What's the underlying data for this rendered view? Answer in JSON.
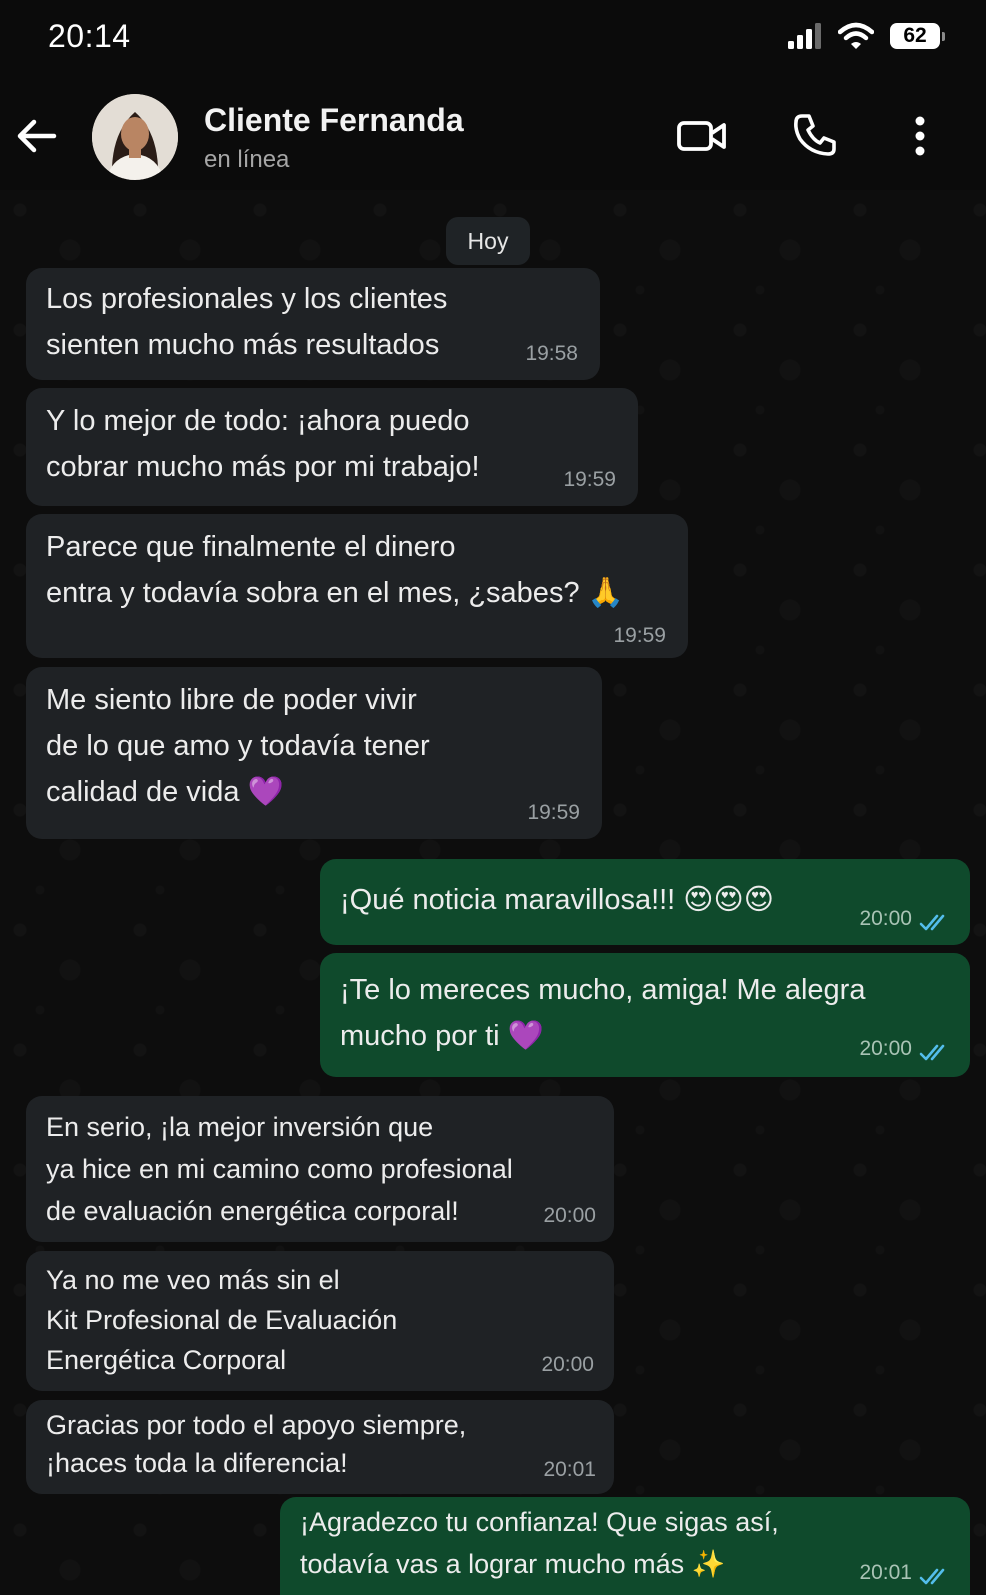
{
  "status_bar": {
    "time": "20:14",
    "signal_icon": "signal-bars-icon",
    "wifi_icon": "wifi-icon",
    "battery_level": "62"
  },
  "header": {
    "contact_name": "Cliente Fernanda",
    "contact_status": "en línea",
    "back_icon": "arrow-left-icon",
    "video_icon": "video-camera-icon",
    "call_icon": "phone-icon",
    "menu_icon": "more-vertical-icon"
  },
  "date_chip": "Hoy",
  "colors": {
    "incoming_bubble": "#1f2225",
    "outgoing_bubble": "#0f4a2c",
    "read_ticks": "#53bdeb",
    "background": "#0b0b0b"
  },
  "messages": [
    {
      "direction": "in",
      "lines": [
        "Los profesionales y los clientes",
        "sienten mucho más resultados"
      ],
      "time": "19:58"
    },
    {
      "direction": "in",
      "lines": [
        "Y lo mejor de todo: ¡ahora puedo",
        "cobrar mucho más por mi trabajo!"
      ],
      "time": "19:59"
    },
    {
      "direction": "in",
      "lines": [
        "Parece que finalmente el dinero",
        "entra y todavía sobra en el mes, ¿sabes? 🙏"
      ],
      "time": "19:59"
    },
    {
      "direction": "in",
      "lines": [
        "Me siento libre de poder vivir",
        "de lo que amo y todavía tener",
        "calidad de vida 💜"
      ],
      "time": "19:59"
    },
    {
      "direction": "out",
      "lines": [
        "¡Qué noticia maravillosa!!! 😍😍😍"
      ],
      "time": "20:00",
      "status": "read"
    },
    {
      "direction": "out",
      "lines": [
        "¡Te lo mereces mucho, amiga! Me alegra",
        "mucho por ti 💜"
      ],
      "time": "20:00",
      "status": "read"
    },
    {
      "direction": "in",
      "lines": [
        "En serio, ¡la mejor inversión que",
        "ya hice en mi camino como profesional",
        "de evaluación energética corporal!"
      ],
      "time": "20:00"
    },
    {
      "direction": "in",
      "lines": [
        "Ya no me veo más sin el",
        "Kit Profesional de Evaluación",
        "Energética Corporal"
      ],
      "time": "20:00"
    },
    {
      "direction": "in",
      "lines": [
        "Gracias por todo el apoyo siempre,",
        "¡haces toda la diferencia!"
      ],
      "time": "20:01"
    },
    {
      "direction": "out",
      "lines": [
        "¡Agradezco tu confianza! Que sigas así,",
        "todavía vas a lograr mucho más ✨"
      ],
      "time": "20:01",
      "status": "read"
    }
  ]
}
